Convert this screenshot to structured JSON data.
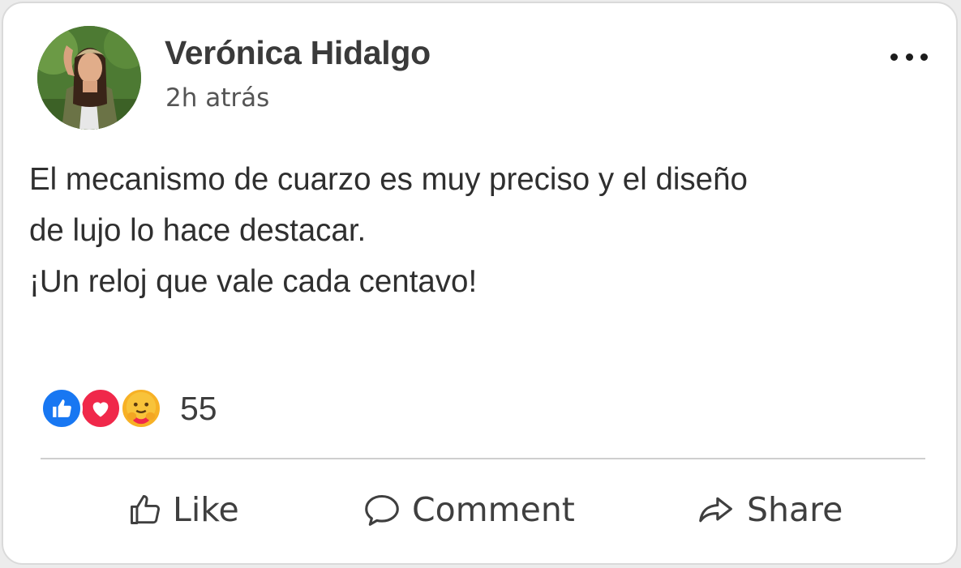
{
  "post": {
    "author": "Verónica Hidalgo",
    "timestamp": "2h atrás",
    "text_lines": [
      "El mecanismo de cuarzo es muy preciso y el diseño",
      "de lujo lo hace destacar.",
      "¡Un reloj que vale cada centavo!"
    ]
  },
  "reactions": {
    "types": [
      "like",
      "love",
      "care"
    ],
    "count": "55"
  },
  "actions": {
    "like_label": "Like",
    "comment_label": "Comment",
    "share_label": "Share"
  },
  "colors": {
    "like_blue": "#1877f2",
    "love_red": "#f0284a",
    "care_yellow": "#f7b125",
    "text": "#2f2f2f"
  },
  "icons": {
    "more": "more-options-icon",
    "like": "thumbs-up-icon",
    "comment": "speech-bubble-icon",
    "share": "share-arrow-icon"
  }
}
